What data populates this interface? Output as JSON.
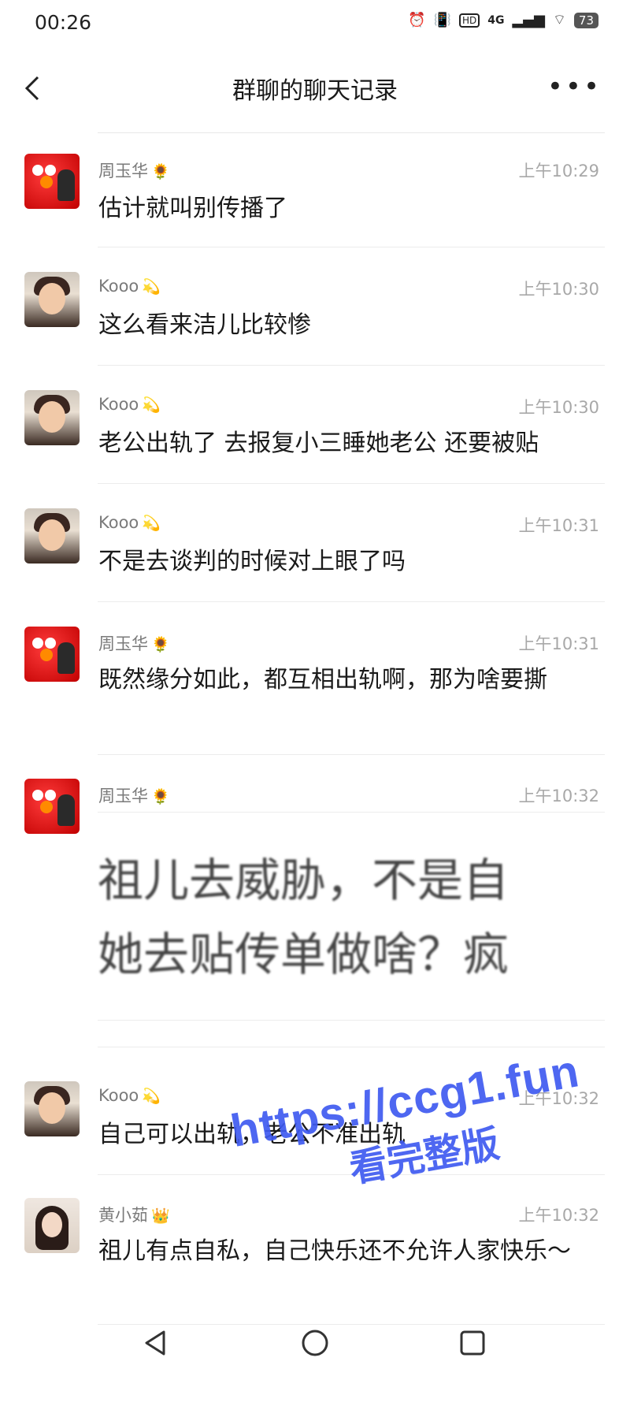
{
  "status": {
    "time": "00:26",
    "signal": "4G",
    "battery": "73",
    "icons": [
      "alarm-icon",
      "vibrate-icon",
      "hd-icon",
      "signal-icon",
      "wifi-icon",
      "battery-icon"
    ]
  },
  "header": {
    "title": "群聊的聊天记录",
    "back_icon": "back-chevron-icon",
    "more_icon": "more-dots-icon",
    "more_label": "•••"
  },
  "colors": {
    "watermark": "#3f5bf0",
    "timestamp": "#a8a8a8",
    "name": "#7a7a7a"
  },
  "messages": [
    {
      "name": "周玉华",
      "badge": "🌻",
      "time": "上午10:29",
      "text": "估计就叫别传播了",
      "avatar": "elmo-avatar"
    },
    {
      "name": "Kooo",
      "badge": "💫",
      "time": "上午10:30",
      "text": "这么看来洁儿比较惨",
      "avatar": "child-avatar"
    },
    {
      "name": "Kooo",
      "badge": "💫",
      "time": "上午10:30",
      "text": "老公出轨了 去报复小三睡她老公 还要被贴",
      "avatar": "child-avatar"
    },
    {
      "name": "Kooo",
      "badge": "💫",
      "time": "上午10:31",
      "text": "不是去谈判的时候对上眼了吗",
      "avatar": "child-avatar"
    },
    {
      "name": "周玉华",
      "badge": "🌻",
      "time": "上午10:31",
      "text": "既然缘分如此，都互相出轨啊，那为啥要撕",
      "avatar": "elmo-avatar"
    },
    {
      "name": "周玉华",
      "badge": "🌻",
      "time": "上午10:32",
      "image_text": [
        "祖儿去威胁，不是自",
        "她去贴传单做啥？疯"
      ],
      "avatar": "elmo-avatar"
    },
    {
      "name": "Kooo",
      "badge": "💫",
      "time": "上午10:32",
      "text": "自己可以出轨，老公不准出轨",
      "avatar": "child-avatar"
    },
    {
      "name": "黄小茹",
      "badge": "👑",
      "time": "上午10:32",
      "text": "祖儿有点自私，自己快乐还不允许人家快乐～",
      "avatar": "woman-avatar"
    }
  ],
  "watermark": {
    "url": "https://ccg1.fun",
    "caption": "看完整版"
  },
  "navbar": {
    "back_icon": "nav-back-icon",
    "home_icon": "nav-home-icon",
    "recents_icon": "nav-recents-icon"
  }
}
